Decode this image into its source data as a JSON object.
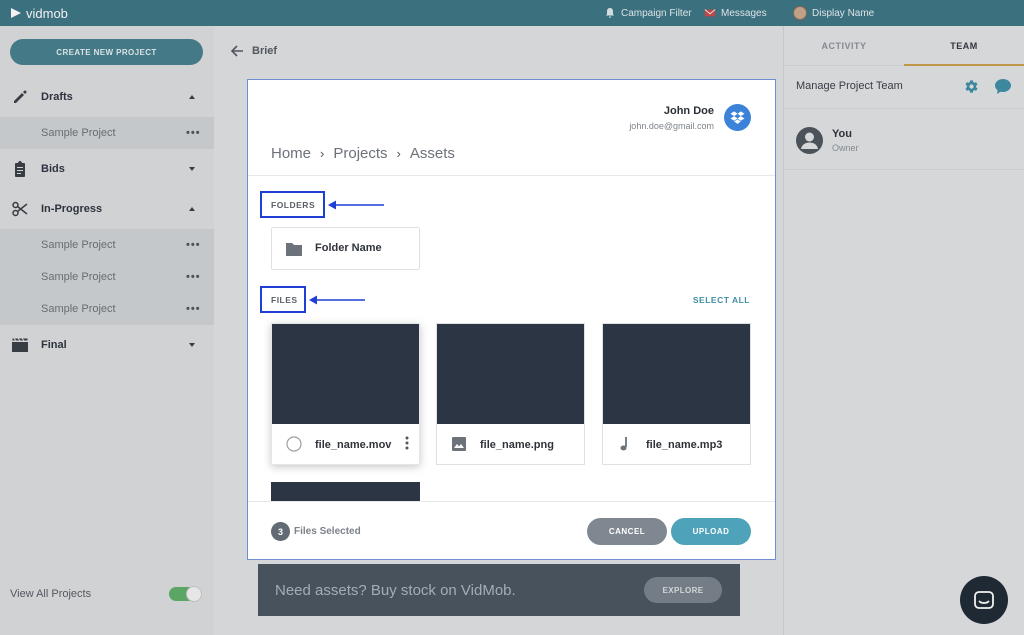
{
  "topbar": {
    "logo_text": "vidmob",
    "campaign_filter": "Campaign Filter",
    "messages": "Messages",
    "display_name": "Display Name"
  },
  "sidebar": {
    "create_button": "CREATE NEW PROJECT",
    "sections": [
      {
        "label": "Drafts",
        "icon": "pencil-icon",
        "expanded": true
      },
      {
        "label": "Bids",
        "icon": "clipboard-icon",
        "expanded": false
      },
      {
        "label": "In-Progress",
        "icon": "scissors-icon",
        "expanded": true
      },
      {
        "label": "Final",
        "icon": "clapperboard-icon",
        "expanded": false
      }
    ],
    "draft_items": [
      "Sample Project"
    ],
    "inprogress_items": [
      "Sample Project",
      "Sample Project",
      "Sample Project"
    ],
    "view_all": "View All Projects",
    "view_all_toggle_on": true
  },
  "center": {
    "back_label": "Brief",
    "promo_text": "Need assets? Buy stock on VidMob.",
    "explore_button": "EXPLORE"
  },
  "right_panel": {
    "tabs": [
      "ACTIVITY",
      "TEAM"
    ],
    "active_tab": "TEAM",
    "manage_title": "Manage Project Team",
    "member": {
      "name": "You",
      "role": "Owner"
    }
  },
  "modal": {
    "user": {
      "name": "John Doe",
      "email": "john.doe@gmail.com"
    },
    "breadcrumb": [
      "Home",
      "Projects",
      "Assets"
    ],
    "folders_label": "FOLDERS",
    "folders": [
      {
        "name": "Folder Name"
      }
    ],
    "files_label": "FILES",
    "select_all": "SELECT ALL",
    "files": [
      {
        "name": "file_name.mov",
        "icon": "radio-circle-icon"
      },
      {
        "name": "file_name.png",
        "icon": "image-icon"
      },
      {
        "name": "file_name.mp3",
        "icon": "music-note-icon"
      }
    ],
    "selected_count": "3",
    "selected_text": "Files Selected",
    "cancel_button": "CANCEL",
    "upload_button": "UPLOAD"
  },
  "colors": {
    "topbar": "#3d7585",
    "accent_teal": "#4ea2b9",
    "highlight_box": "#1d3fd6",
    "thumbnail": "#2b3543",
    "tab_underline": "#c9a04d"
  }
}
